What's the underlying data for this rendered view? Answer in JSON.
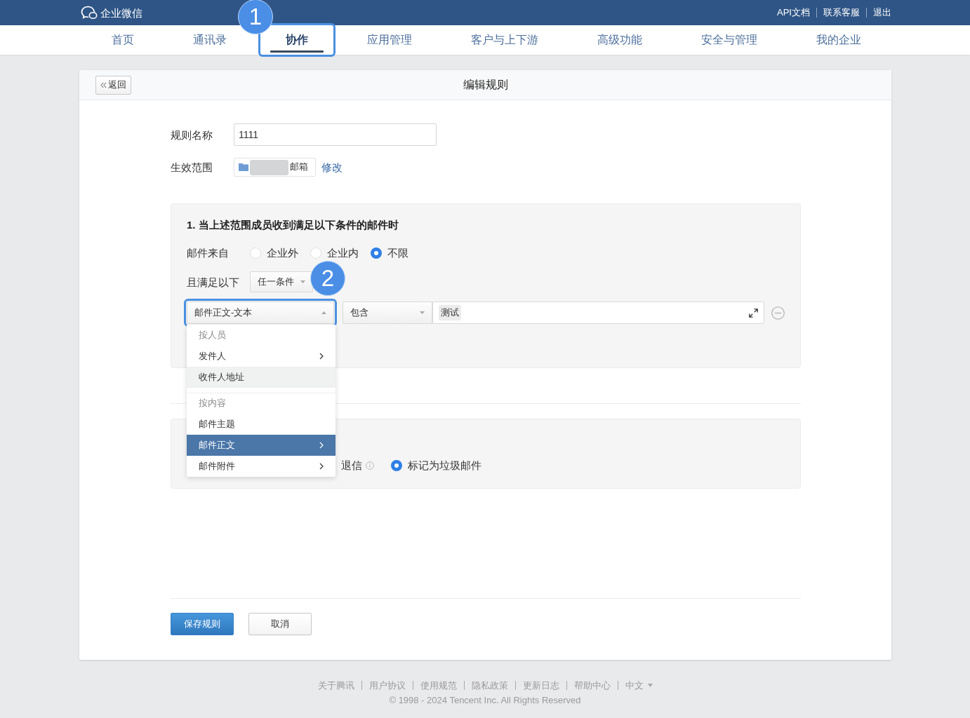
{
  "header": {
    "logo": "企业微信",
    "links": [
      "API文档",
      "联系客服",
      "退出"
    ]
  },
  "nav": {
    "tabs": [
      {
        "label": "首页",
        "selected": false,
        "highlighted": false
      },
      {
        "label": "通讯录",
        "selected": false,
        "highlighted": false
      },
      {
        "label": "协作",
        "selected": true,
        "highlighted": true,
        "callout": "1"
      },
      {
        "label": "应用管理",
        "selected": false,
        "highlighted": false
      },
      {
        "label": "客户与上下游",
        "selected": false,
        "highlighted": false
      },
      {
        "label": "高级功能",
        "selected": false,
        "highlighted": false
      },
      {
        "label": "安全与管理",
        "selected": false,
        "highlighted": false
      },
      {
        "label": "我的企业",
        "selected": false,
        "highlighted": false
      }
    ]
  },
  "card": {
    "back": "返回",
    "title": "编辑规则"
  },
  "form": {
    "name": {
      "label": "规则名称",
      "value": "1111"
    },
    "scope": {
      "label": "生效范围",
      "redacted": true,
      "value": "邮箱",
      "action": "修改"
    }
  },
  "conditions": {
    "title": "1. 当上述范围成员收到满足以下条件的邮件时",
    "source": {
      "label": "邮件来自",
      "options": [
        {
          "label": "企业外",
          "selected": false
        },
        {
          "label": "企业内",
          "selected": false
        },
        {
          "label": "不限",
          "selected": true
        }
      ]
    },
    "match": {
      "label": "且满足以下",
      "value": "任一条件",
      "callout": "2"
    },
    "rule": {
      "field": "邮件正文-文本",
      "expanded": true,
      "highlighted": true,
      "operator": "包含",
      "tags": [
        "测试"
      ]
    },
    "menu": [
      {
        "kind": "header",
        "label": "按人员"
      },
      {
        "kind": "item",
        "label": "发件人",
        "submenu": true,
        "selected": false,
        "hovered": false
      },
      {
        "kind": "item",
        "label": "收件人地址",
        "submenu": false,
        "selected": false,
        "hovered": true
      },
      {
        "kind": "header",
        "label": "按内容"
      },
      {
        "kind": "item",
        "label": "邮件主题",
        "submenu": false,
        "selected": false,
        "hovered": false
      },
      {
        "kind": "item",
        "label": "邮件正文",
        "submenu": true,
        "selected": true,
        "hovered": false
      },
      {
        "kind": "item",
        "label": "邮件附件",
        "submenu": true,
        "selected": false,
        "hovered": false
      }
    ]
  },
  "actions": {
    "options": [
      {
        "label": "退信",
        "info": true
      },
      {
        "label": "标记为垃圾邮件",
        "selected": true,
        "info": false
      }
    ]
  },
  "buttons": [
    {
      "label": "保存规则",
      "kind": "primary"
    },
    {
      "label": "取消",
      "kind": "secondary"
    }
  ],
  "footer": {
    "links": [
      {
        "label": "关于腾讯",
        "kind": "link"
      },
      {
        "label": "用户协议",
        "kind": "link"
      },
      {
        "label": "使用规范",
        "kind": "link"
      },
      {
        "label": "隐私政策",
        "kind": "link"
      },
      {
        "label": "更新日志",
        "kind": "link"
      },
      {
        "label": "帮助中心",
        "kind": "link"
      },
      {
        "label": "中文",
        "kind": "language"
      }
    ],
    "copyright": "© 1998 - 2024 Tencent Inc. All Rights Reserved"
  }
}
